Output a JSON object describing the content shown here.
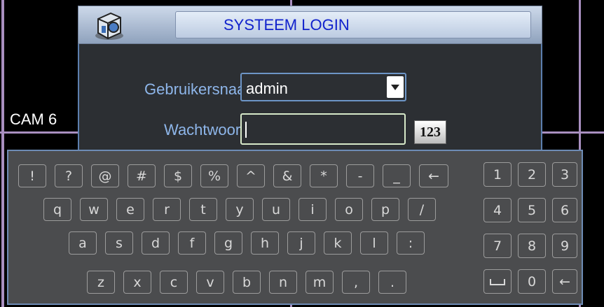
{
  "background": {
    "cam_label": "CAM 6"
  },
  "dialog": {
    "title": "SYSTEEM LOGIN",
    "username_label": "Gebruikersnaam",
    "username_value": "admin",
    "password_label": "Wachtwoord",
    "password_value": "",
    "input_mode_label": "123"
  },
  "keyboard": {
    "row1": [
      "!",
      "?",
      "@",
      "#",
      "$",
      "%",
      "^",
      "&",
      "*",
      "-",
      "_",
      "←"
    ],
    "row2": [
      "q",
      "w",
      "e",
      "r",
      "t",
      "y",
      "u",
      "i",
      "o",
      "p",
      "/"
    ],
    "row3": [
      "a",
      "s",
      "d",
      "f",
      "g",
      "h",
      "j",
      "k",
      "l",
      ":"
    ],
    "row4": [
      "z",
      "x",
      "c",
      "v",
      "b",
      "n",
      "m",
      ",",
      "."
    ],
    "numpad": [
      [
        "1",
        "2",
        "3"
      ],
      [
        "4",
        "5",
        "6"
      ],
      [
        "7",
        "8",
        "9"
      ],
      [
        "␣",
        "0",
        "←"
      ]
    ]
  },
  "colors": {
    "background": "#000000",
    "grid_line": "#a98fc0",
    "title_text": "#1122cc",
    "field_label": "#8eb6ea",
    "dialog_body": "#2c2f33",
    "keyboard_body": "#4b4c4e"
  }
}
